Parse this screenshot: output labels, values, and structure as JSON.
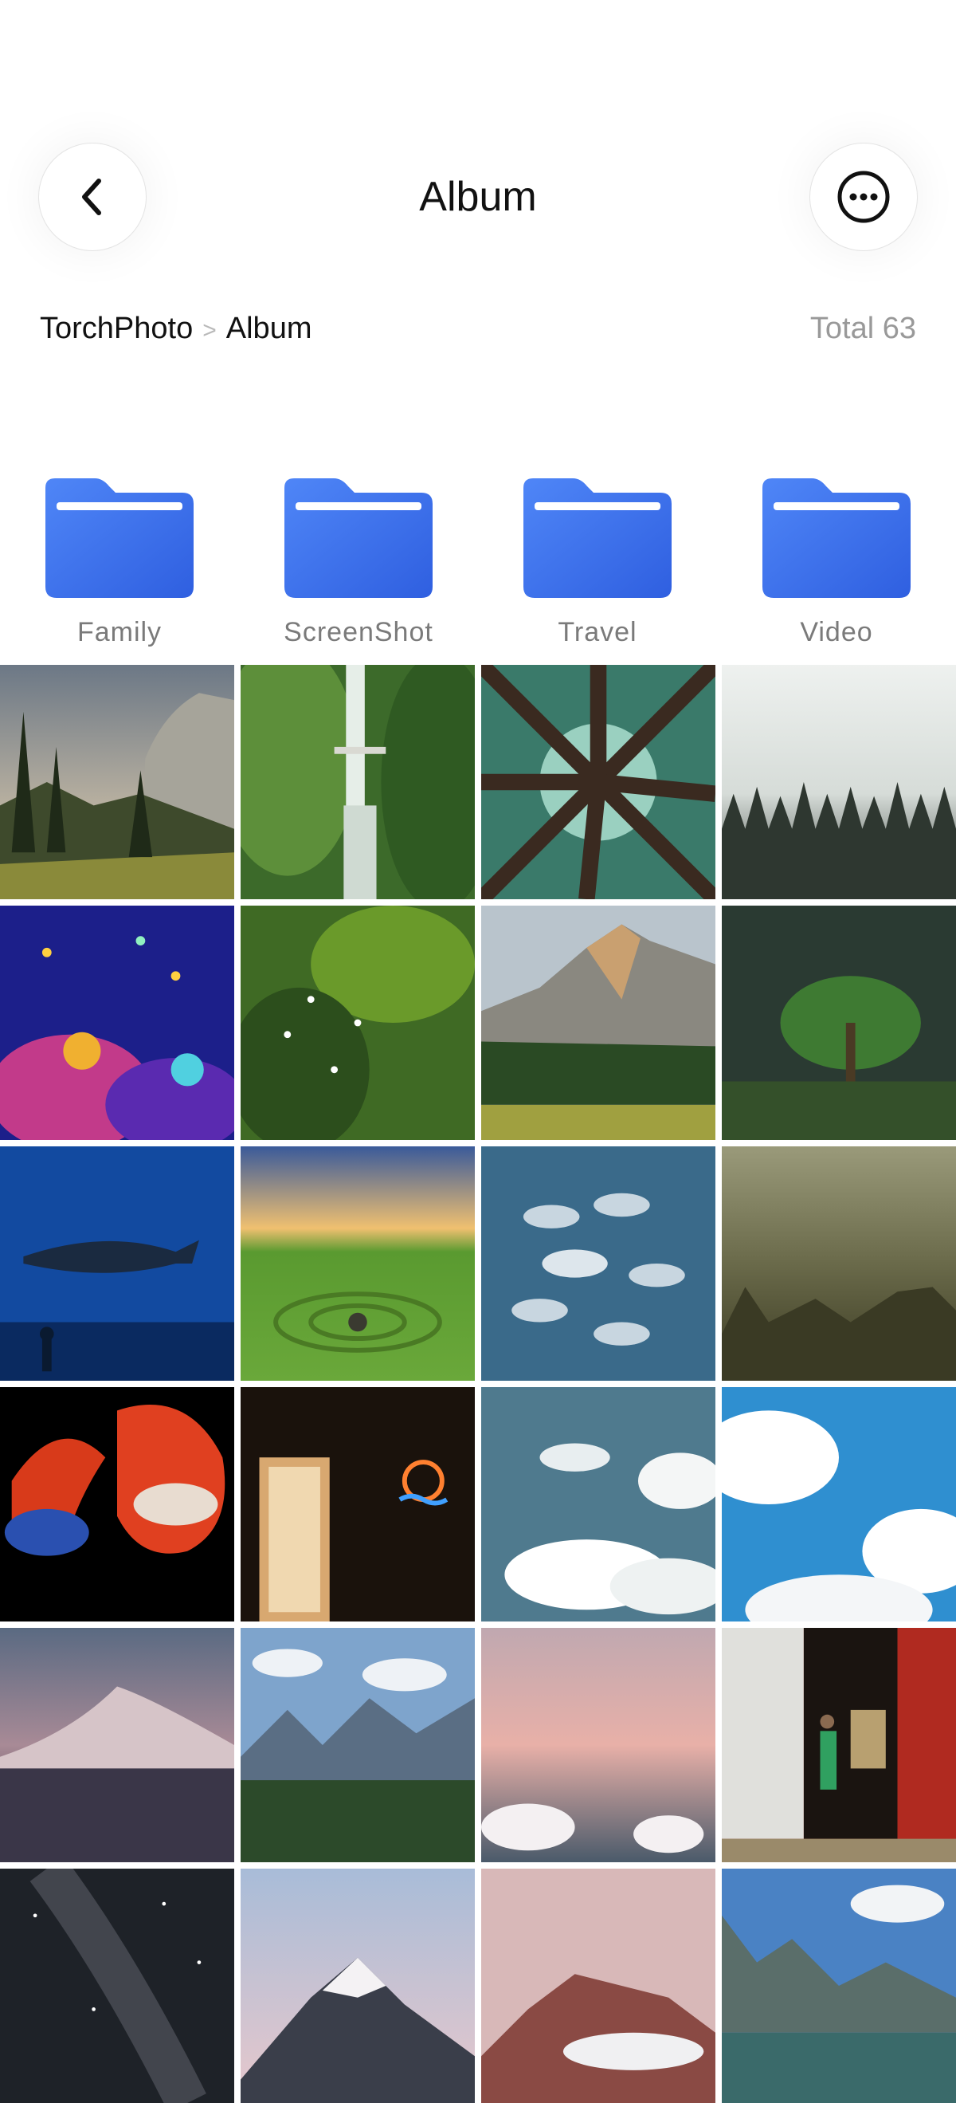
{
  "header": {
    "title": "Album",
    "back_icon": "chevron-left-icon",
    "more_icon": "more-horizontal-icon"
  },
  "breadcrumb": {
    "root": "TorchPhoto",
    "separator": ">",
    "current": "Album"
  },
  "total_label": "Total 63",
  "folders": [
    {
      "label": "Family",
      "icon": "folder-icon"
    },
    {
      "label": "ScreenShot",
      "icon": "folder-icon"
    },
    {
      "label": "Travel",
      "icon": "folder-icon"
    },
    {
      "label": "Video",
      "icon": "folder-icon"
    }
  ],
  "colors": {
    "folder_blue_light": "#4f86f7",
    "folder_blue_dark": "#2f5fe0",
    "label_gray": "#7a7a7a",
    "total_gray": "#999999"
  },
  "photos": [
    "mountain-cliff-pines",
    "waterfall-bridge",
    "redwood-canopy",
    "foggy-forest",
    "coral-reef-aquarium",
    "green-bokeh-leaves",
    "half-dome-valley",
    "moss-sprout",
    "whale-shark-aquarium",
    "spiral-valley-sunset",
    "fish-school",
    "hazy-mountain-cliffs",
    "betta-fish-pair",
    "window-neon-sign",
    "teal-sky-clouds",
    "blue-sky-clouds",
    "snow-mountain-dusk",
    "alpine-valley",
    "pink-cloudscape",
    "shipping-container-worker",
    "milky-way-night",
    "snowy-peak-pink-sky",
    "red-rock-peak",
    "mountain-lake-reflection"
  ]
}
